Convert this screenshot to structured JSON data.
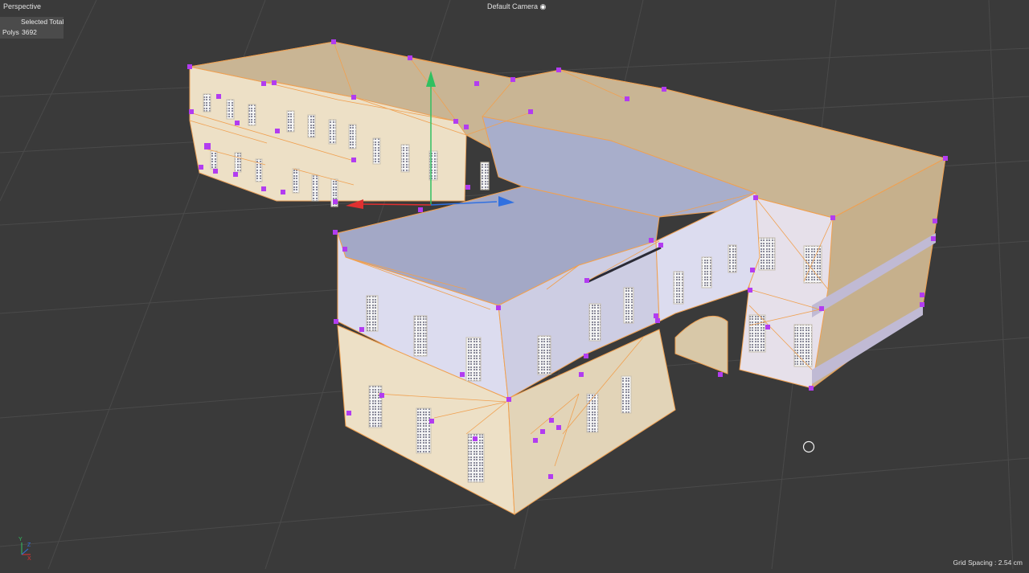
{
  "viewport": {
    "view_label": "Perspective",
    "camera_label": "Default Camera",
    "camera_icon": "camera-target-icon",
    "hud": {
      "selected_label": "Selected Total",
      "polys_label": "Polys",
      "polys_value": "3692"
    },
    "grid_spacing": "Grid Spacing : 2.54 cm",
    "axis_labels": {
      "x": "X",
      "y": "Y",
      "z": "Z"
    }
  },
  "colors": {
    "background": "#3a3a3a",
    "grid_line": "#4a4a4a",
    "roof_warm": "#c9b594",
    "roof_cool": "#a3a8c6",
    "wall_warm": "#ede0c6",
    "wall_cool": "#d8d8ec",
    "edge_orange": "#f0a050",
    "vertex_magenta": "#b23cf0",
    "axis_x": "#e03030",
    "axis_y": "#30c060",
    "axis_z": "#3070e0"
  }
}
